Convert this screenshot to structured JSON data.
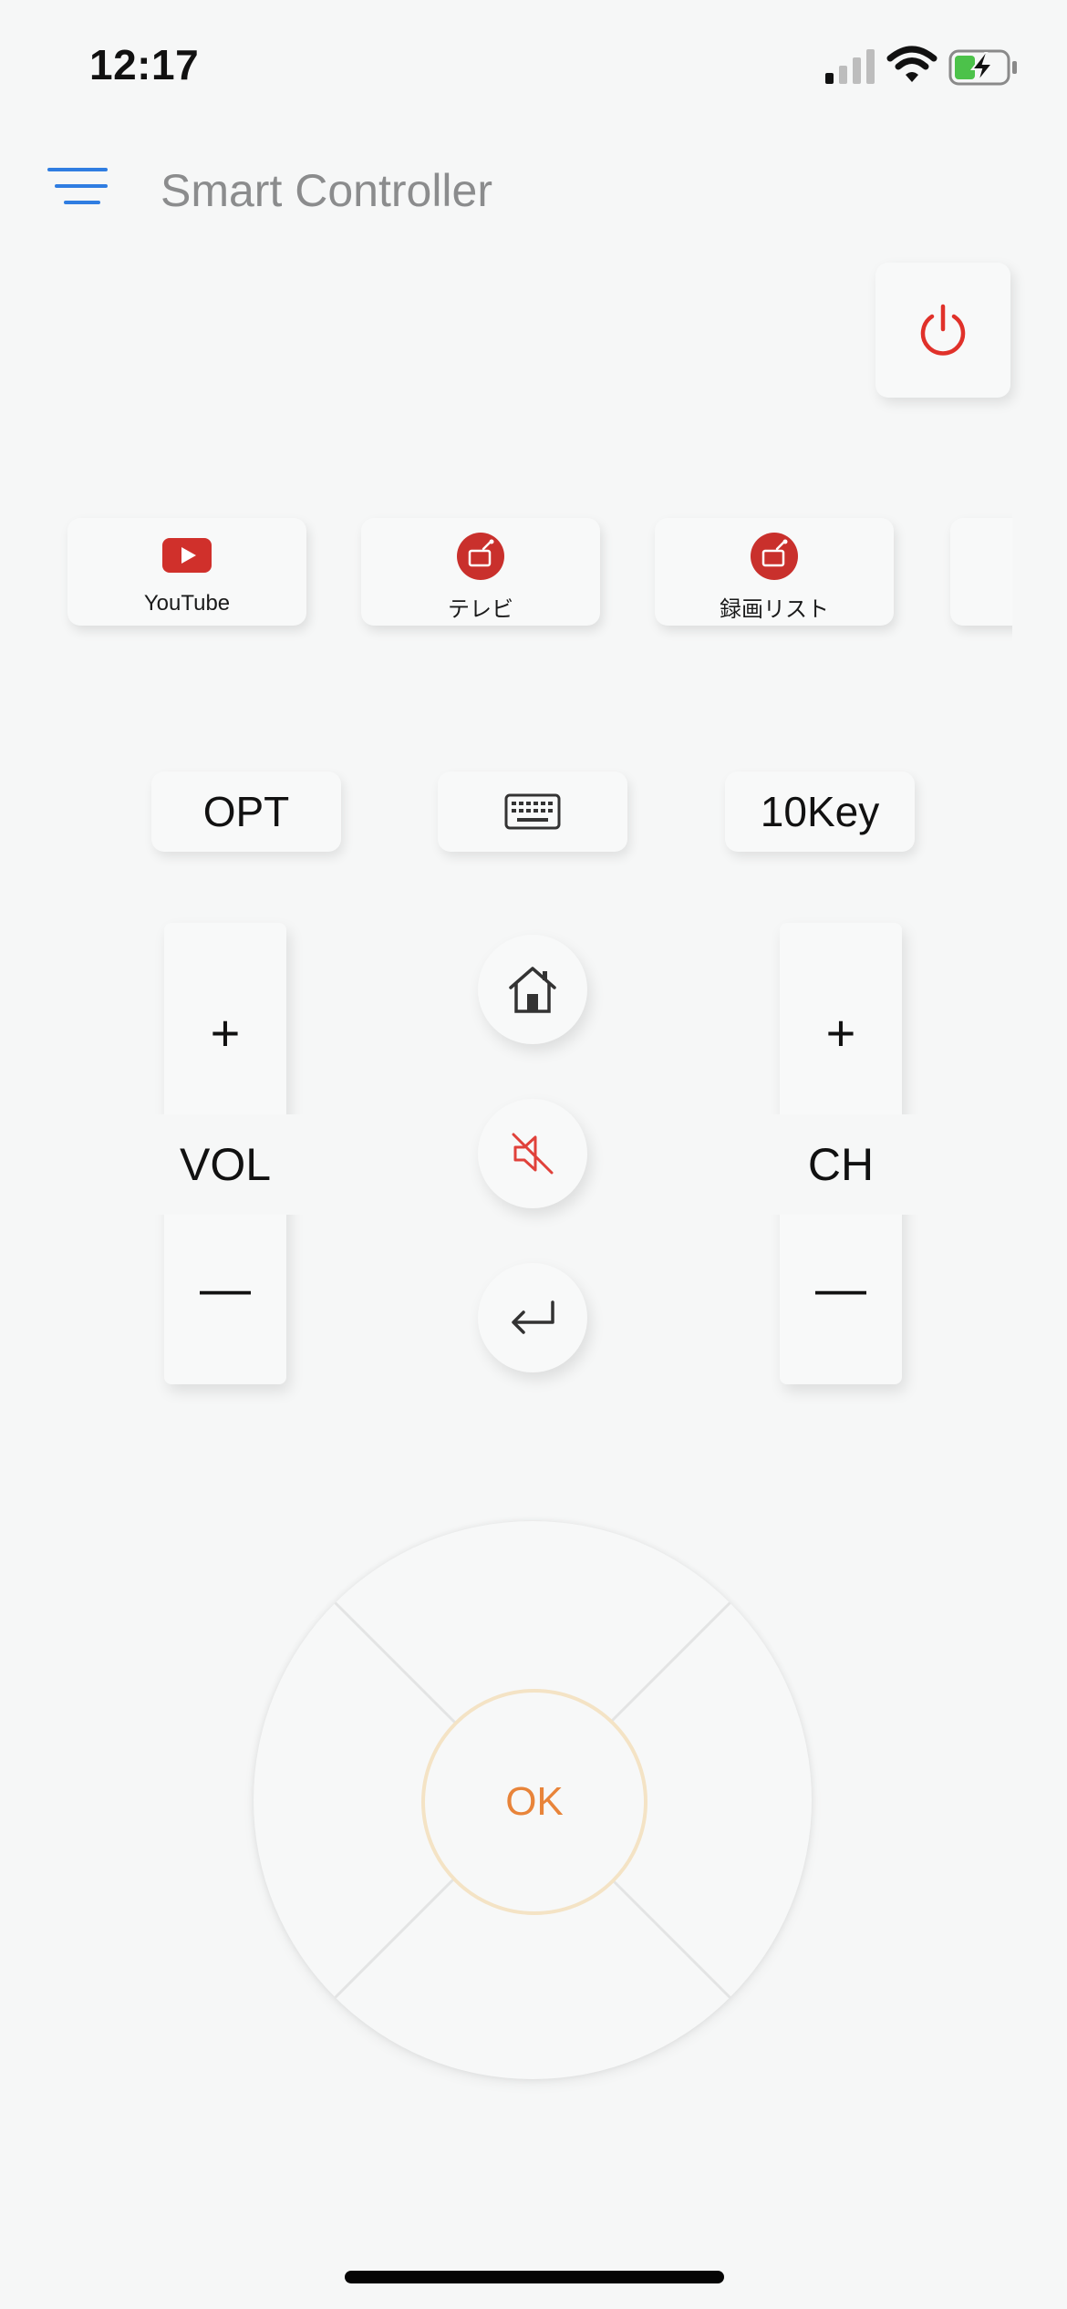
{
  "status_bar": {
    "time": "12:17"
  },
  "header": {
    "title": "Smart Controller",
    "menu_icon": "hamburger-menu-icon"
  },
  "power": {
    "icon": "power-icon",
    "color": "#e0312a"
  },
  "apps": [
    {
      "label": "YouTube",
      "icon": "youtube-icon"
    },
    {
      "label": "テレビ",
      "icon": "tv-icon"
    },
    {
      "label": "録画リスト",
      "icon": "tv-icon"
    }
  ],
  "options": {
    "opt": "OPT",
    "keyboard_icon": "keyboard-icon",
    "tenkey": "10Key"
  },
  "volume": {
    "plus": "+",
    "label": "VOL",
    "minus": "—"
  },
  "channel": {
    "plus": "+",
    "label": "CH",
    "minus": "—"
  },
  "center_buttons": [
    "home-icon",
    "mute-icon",
    "return-icon"
  ],
  "dpad": {
    "ok": "OK",
    "ok_color": "#e8843a"
  },
  "colors": {
    "accent_blue": "#2f7de1",
    "app_red": "#d0302b",
    "background": "#f6f7f7"
  }
}
